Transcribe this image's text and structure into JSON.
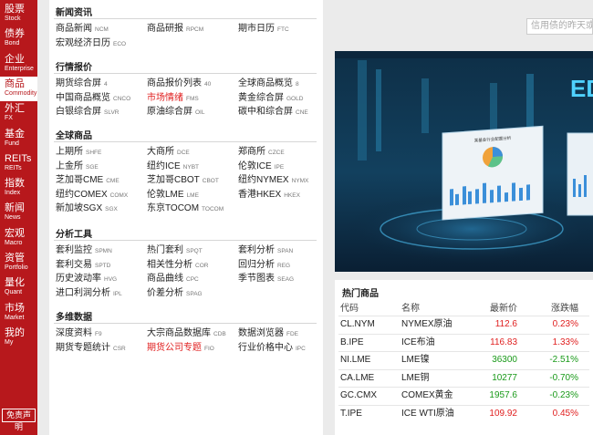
{
  "sidebar": {
    "items": [
      {
        "cn": "股票",
        "en": "Stock"
      },
      {
        "cn": "债券",
        "en": "Bond"
      },
      {
        "cn": "企业",
        "en": "Enterprise"
      },
      {
        "cn": "商品",
        "en": "Commodity",
        "active": true
      },
      {
        "cn": "外汇",
        "en": "FX"
      },
      {
        "cn": "基金",
        "en": "Fund"
      },
      {
        "cn": "REITs",
        "en": "REITs"
      },
      {
        "cn": "指数",
        "en": "Index"
      },
      {
        "cn": "新闻",
        "en": "News"
      },
      {
        "cn": "宏观",
        "en": "Macro"
      },
      {
        "cn": "资管",
        "en": "Portfolio"
      },
      {
        "cn": "量化",
        "en": "Quant"
      },
      {
        "cn": "市场",
        "en": "Market"
      },
      {
        "cn": "我的",
        "en": "My"
      }
    ],
    "disclaimer": "免责声明"
  },
  "search": {
    "placeholder": "信用债的昨天或"
  },
  "sections": [
    {
      "title": "新闻资讯",
      "rows": [
        [
          {
            "name": "商品新闻",
            "code": "NCM"
          },
          {
            "name": "商品研报",
            "code": "RPCM"
          },
          {
            "name": "期市日历",
            "code": "FTC"
          }
        ],
        [
          {
            "name": "宏观经济日历",
            "code": "ECO"
          }
        ]
      ]
    },
    {
      "title": "行情报价",
      "rows": [
        [
          {
            "name": "期货综合屏",
            "code": "4"
          },
          {
            "name": "商品报价列表",
            "code": "40"
          },
          {
            "name": "全球商品概览",
            "code": "8"
          }
        ],
        [
          {
            "name": "中国商品概览",
            "code": "CNCO"
          },
          {
            "name": "市场情绪",
            "code": "FMS",
            "red": true
          },
          {
            "name": "黄金综合屏",
            "code": "GOLD"
          }
        ],
        [
          {
            "name": "白银综合屏",
            "code": "SLVR"
          },
          {
            "name": "原油综合屏",
            "code": "OIL"
          },
          {
            "name": "碳中和综合屏",
            "code": "CNE"
          }
        ]
      ]
    },
    {
      "title": "全球商品",
      "rows": [
        [
          {
            "name": "上期所",
            "code": "SHFE"
          },
          {
            "name": "大商所",
            "code": "DCE"
          },
          {
            "name": "郑商所",
            "code": "CZCE"
          }
        ],
        [
          {
            "name": "上金所",
            "code": "SGE"
          },
          {
            "name": "纽约ICE",
            "code": "NYBT"
          },
          {
            "name": "伦敦ICE",
            "code": "IPE"
          }
        ],
        [
          {
            "name": "芝加哥CME",
            "code": "CME"
          },
          {
            "name": "芝加哥CBOT",
            "code": "CBOT"
          },
          {
            "name": "纽约NYMEX",
            "code": "NYMX"
          }
        ],
        [
          {
            "name": "纽约COMEX",
            "code": "COMX"
          },
          {
            "name": "伦敦LME",
            "code": "LME"
          },
          {
            "name": "香港HKEX",
            "code": "HKEX"
          }
        ],
        [
          {
            "name": "新加坡SGX",
            "code": "SGX"
          },
          {
            "name": "东京TOCOM",
            "code": "TOCOM"
          }
        ]
      ]
    },
    {
      "title": "分析工具",
      "rows": [
        [
          {
            "name": "套利监控",
            "code": "SPMN"
          },
          {
            "name": "热门套利",
            "code": "SPQT"
          },
          {
            "name": "套利分析",
            "code": "SPAN"
          }
        ],
        [
          {
            "name": "套利交易",
            "code": "SPTD"
          },
          {
            "name": "相关性分析",
            "code": "COR"
          },
          {
            "name": "回归分析",
            "code": "REG"
          }
        ],
        [
          {
            "name": "历史波动率",
            "code": "HVG"
          },
          {
            "name": "商品曲线",
            "code": "CPC"
          },
          {
            "name": "季节图表",
            "code": "SEAG"
          }
        ],
        [
          {
            "name": "进口利润分析",
            "code": "IPL"
          },
          {
            "name": "价差分析",
            "code": "SPAG"
          }
        ]
      ]
    },
    {
      "title": "多维数据",
      "rows": [
        [
          {
            "name": "深度资料",
            "code": "F9"
          },
          {
            "name": "大宗商品数据库",
            "code": "CDB"
          },
          {
            "name": "数据浏览器",
            "code": "FDE"
          }
        ],
        [
          {
            "name": "期货专题统计",
            "code": "CSR"
          },
          {
            "name": "期货公司专题",
            "code": "FIO",
            "red": true
          },
          {
            "name": "行业价格中心",
            "code": "IPC"
          }
        ]
      ]
    }
  ],
  "banner": {
    "text": "ED",
    "chart_title": "某基金行业配置分析"
  },
  "hot": {
    "title": "热门商品",
    "headers": [
      "代码",
      "名称",
      "最新价",
      "涨跌幅"
    ],
    "rows": [
      {
        "code": "CL.NYM",
        "name": "NYMEX原油",
        "price": "112.6",
        "chg": "0.23%",
        "dir": "up"
      },
      {
        "code": "B.IPE",
        "name": "ICE布油",
        "price": "116.83",
        "chg": "1.33%",
        "dir": "up"
      },
      {
        "code": "NI.LME",
        "name": "LME镍",
        "price": "36300",
        "chg": "-2.51%",
        "dir": "down"
      },
      {
        "code": "CA.LME",
        "name": "LME铜",
        "price": "10277",
        "chg": "-0.70%",
        "dir": "down"
      },
      {
        "code": "GC.CMX",
        "name": "COMEX黄金",
        "price": "1957.6",
        "chg": "-0.23%",
        "dir": "down"
      },
      {
        "code": "T.IPE",
        "name": "ICE WTI原油",
        "price": "109.92",
        "chg": "0.45%",
        "dir": "up"
      }
    ],
    "colors": {
      "up": "#e02020",
      "down": "#1a9a1a"
    }
  }
}
